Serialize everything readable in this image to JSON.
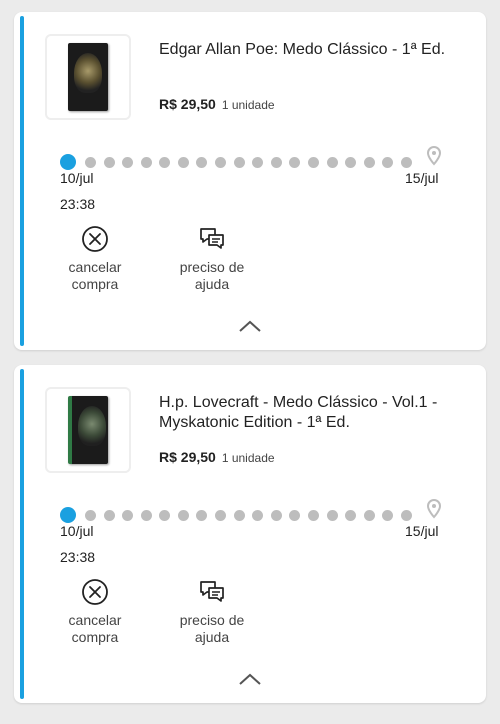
{
  "orders": [
    {
      "title": "Edgar Allan Poe: Medo Clássico - 1ª Ed.",
      "price": "R$ 29,50",
      "quantity": "1 unidade",
      "start_date": "10/jul",
      "start_time": "23:38",
      "end_date": "15/jul",
      "progress": 0,
      "cancel_label_1": "cancelar",
      "cancel_label_2": "compra",
      "help_label_1": "preciso de",
      "help_label_2": "ajuda"
    },
    {
      "title": "H.p. Lovecraft - Medo Clássico - Vol.1 - Myskatonic Edition - 1ª Ed.",
      "price": "R$ 29,50",
      "quantity": "1 unidade",
      "start_date": "10/jul",
      "start_time": "23:38",
      "end_date": "15/jul",
      "progress": 0,
      "cancel_label_1": "cancelar",
      "cancel_label_2": "compra",
      "help_label_1": "preciso de",
      "help_label_2": "ajuda"
    }
  ],
  "colors": {
    "accent": "#1aa0e0",
    "inactive_dot": "#bdbdbd",
    "background": "#ebebeb"
  },
  "icons": {
    "cancel": "x-circle-icon",
    "help": "chat-bubbles-icon",
    "destination": "map-pin-icon",
    "collapse": "chevron-up-icon"
  }
}
